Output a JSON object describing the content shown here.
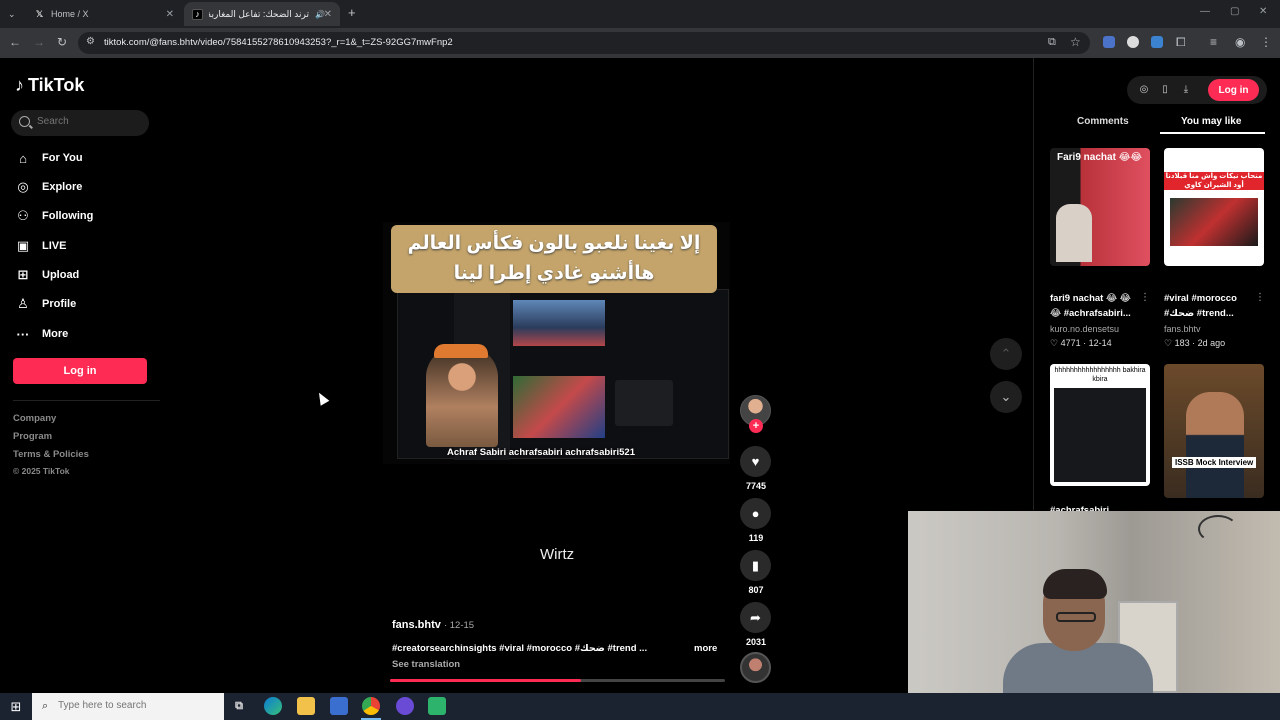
{
  "browser": {
    "tabs": [
      {
        "title": "Home / X",
        "favicon": "x-logo-icon"
      },
      {
        "title": "ترند الضحك: تفاعل المغاربة ...",
        "favicon": "tiktok-logo-icon"
      }
    ],
    "new_tab_symbol": "+",
    "url": "tiktok.com/@fans.bhtv/video/7584155278610943253?_r=1&_t=ZS-92GG7mwFnp2"
  },
  "sidebar": {
    "logo_text": "TikTok",
    "search_placeholder": "Search",
    "items": [
      {
        "label": "For You",
        "icon": "home-icon"
      },
      {
        "label": "Explore",
        "icon": "compass-icon"
      },
      {
        "label": "Following",
        "icon": "user-icon"
      },
      {
        "label": "LIVE",
        "icon": "live-icon"
      },
      {
        "label": "Upload",
        "icon": "upload-icon"
      },
      {
        "label": "Profile",
        "icon": "profile-icon"
      },
      {
        "label": "More",
        "icon": "more-dots-icon"
      }
    ],
    "login_label": "Log in",
    "footer": [
      "Company",
      "Program",
      "Terms & Policies",
      "© 2025 TikTok"
    ]
  },
  "video": {
    "caption_line1": "إلا بغينا نلعبو بالون فكأس العالم",
    "caption_line2": "هاأشنو غادي إطرا لينا",
    "overlay_handles": "Achraf Sabiri  achrafsabiri  achrafsabiri521",
    "subtitle": "Wirtz",
    "author": "fans.bhtv",
    "date": "· 12-15",
    "description": "#creatorsearchinsights #viral #morocco #ضحك #trend ...",
    "more_label": "more",
    "see_translation": "See translation",
    "progress_fraction": 0.57
  },
  "actions": {
    "likes": "7745",
    "comments": "119",
    "saves": "807",
    "shares": "2031"
  },
  "right_panel": {
    "login_label": "Log in",
    "tabs": [
      "Comments",
      "You may like"
    ],
    "active_tab": "You may like",
    "cards": [
      {
        "overlay": "Fari9 nachat 😂😂",
        "title": "fari9 nachat 😂 😂",
        "title2": "😂 #achrafsabiri...",
        "author": "kuro.no.densetsu",
        "likes": "4771",
        "date": "· 12-14"
      },
      {
        "overlay": "منحاب نيكات واش منا قبلادنا أود الشيران كاوي",
        "title": "#viral #morocco",
        "title2": "#ضحك #trend...",
        "author": "fans.bhtv",
        "likes": "183",
        "date": "· 2d ago"
      },
      {
        "overlay": "hhhhhhhhhhhhhhhhh bakhira kbira",
        "title": "#achrafsabiri",
        "title2": "",
        "author": "",
        "likes": "",
        "date": ""
      },
      {
        "overlay": "ISSB Mock Interview",
        "title": "",
        "title2": "",
        "author": "",
        "likes": "",
        "date": ""
      }
    ]
  },
  "taskbar": {
    "search_placeholder": "Type here to search"
  },
  "colors": {
    "brand_red": "#fe2c55",
    "background": "#000000"
  }
}
